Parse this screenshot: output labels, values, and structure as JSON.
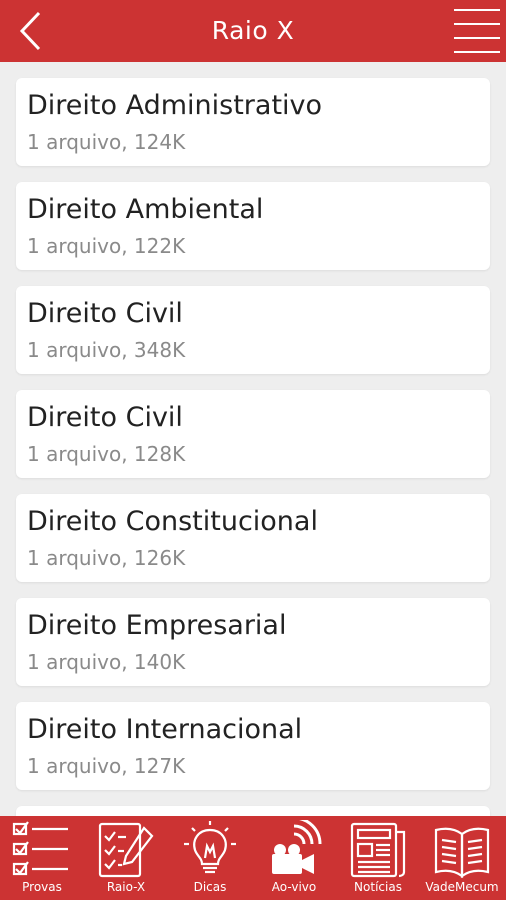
{
  "header": {
    "title": "Raio X",
    "back_icon": "chevron-left-icon",
    "menu_icon": "hamburger-menu-icon",
    "bg_color": "#cc3333"
  },
  "files": [
    {
      "name": "Direito Administrativo",
      "meta": "1 arquivo, 124K"
    },
    {
      "name": "Direito Ambiental",
      "meta": "1 arquivo, 122K"
    },
    {
      "name": "Direito Civil",
      "meta": "1 arquivo, 348K"
    },
    {
      "name": "Direito Civil",
      "meta": "1 arquivo, 128K"
    },
    {
      "name": "Direito Constitucional",
      "meta": "1 arquivo, 126K"
    },
    {
      "name": "Direito Empresarial",
      "meta": "1 arquivo, 140K"
    },
    {
      "name": "Direito Internacional",
      "meta": "1 arquivo, 127K"
    }
  ],
  "tabs": [
    {
      "label": "Provas",
      "icon": "checklist-icon"
    },
    {
      "label": "Raio-X",
      "icon": "clipboard-pencil-icon"
    },
    {
      "label": "Dicas",
      "icon": "lightbulb-icon"
    },
    {
      "label": "Ao-vivo",
      "icon": "video-camera-broadcast-icon"
    },
    {
      "label": "Notícias",
      "icon": "newspaper-icon"
    },
    {
      "label": "VadeMecum",
      "icon": "open-book-icon"
    }
  ]
}
